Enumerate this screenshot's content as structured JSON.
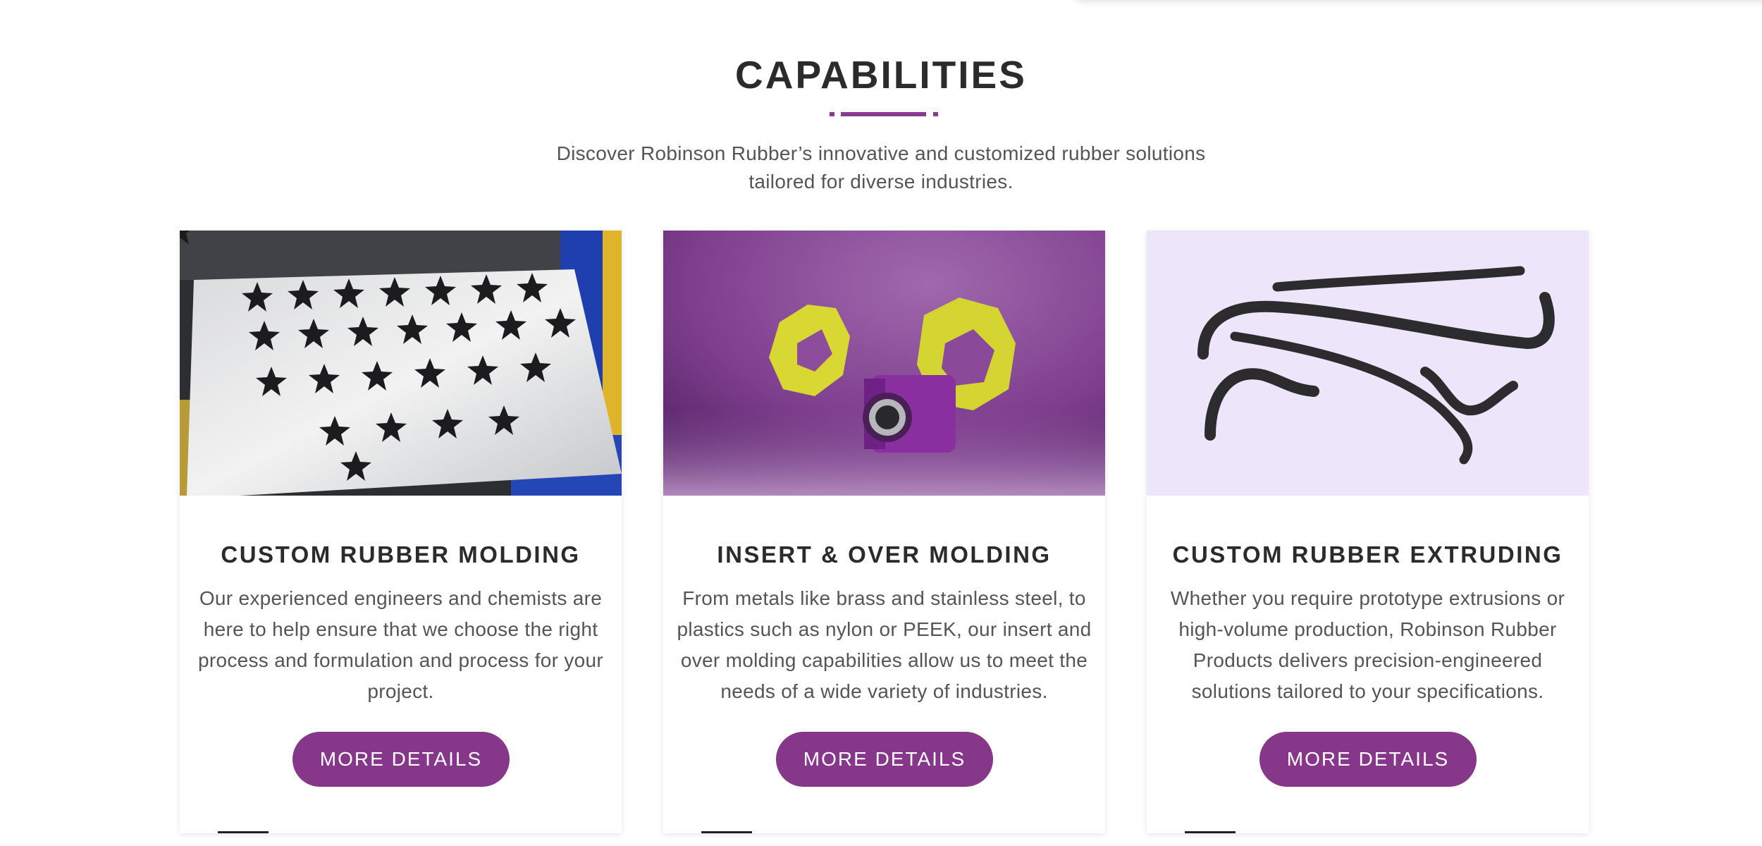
{
  "section": {
    "title": "CAPABILITIES",
    "subtitle": "Discover Robinson Rubber’s innovative and customized rubber solutions tailored for diverse industries."
  },
  "colors": {
    "accent": "#873789",
    "title_text": "#2b2b2b",
    "body_text": "#555555",
    "extrusion_image_bg": "#ede5fa",
    "insert_image_bg": "#8a4a99"
  },
  "cards": [
    {
      "image_icon": "molded-rubber-parts-tray-image",
      "title": "CUSTOM RUBBER MOLDING",
      "description": "Our experienced engineers and chemists are here to help ensure that we choose the right process and formulation and process for your project.",
      "button_label": "MORE DETAILS"
    },
    {
      "image_icon": "insert-molded-parts-image",
      "title": "INSERT & OVER MOLDING",
      "description": "From metals like brass and stainless steel, to plastics such as nylon or PEEK, our insert and over molding capabilities allow us to meet the needs of a wide variety of industries.",
      "button_label": "MORE DETAILS"
    },
    {
      "image_icon": "extruded-rubber-hoses-image",
      "title": "CUSTOM RUBBER EXTRUDING",
      "description": "Whether you require prototype extrusions or high-volume production, Robinson Rubber Products delivers precision-engineered solutions tailored to your specifications.",
      "button_label": "MORE DETAILS"
    }
  ]
}
